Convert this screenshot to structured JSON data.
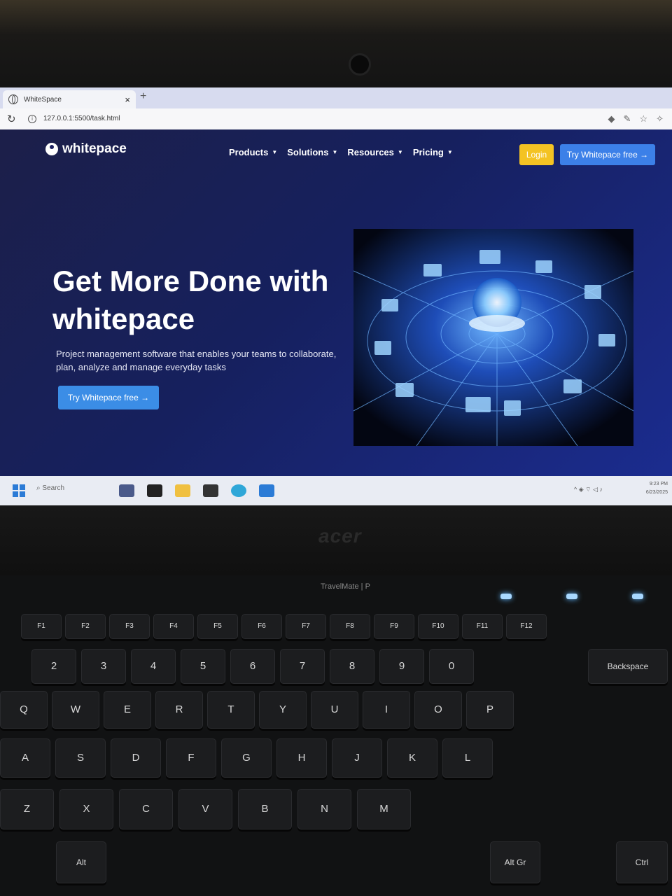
{
  "browser": {
    "tab_title": "WhiteSpace",
    "url": "127.0.0.1:5500/task.html",
    "new_tab": "+"
  },
  "site": {
    "logo": "whitepace",
    "nav": [
      {
        "label": "Products"
      },
      {
        "label": "Solutions"
      },
      {
        "label": "Resources"
      },
      {
        "label": "Pricing"
      }
    ],
    "login": "Login",
    "try_top": "Try Whitepace free →",
    "hero_title": "Get More Done with whitepace",
    "hero_subtitle": "Project management software that enables your teams to collaborate, plan, analyze and manage everyday tasks",
    "hero_button": "Try Whitepace free →",
    "colors": {
      "accent_blue": "#3c80e8",
      "login_yellow": "#f4c323",
      "bg": "#16205e"
    }
  },
  "taskbar": {
    "search": "Search",
    "time": "9:23 PM",
    "date": "6/23/2025"
  },
  "laptop": {
    "brand": "acer",
    "model": "TravelMate | P",
    "keys": [
      "F1",
      "F2",
      "F3",
      "F4",
      "F5",
      "F6",
      "F7",
      "F8",
      "F9",
      "F10",
      "F11",
      "F12",
      "2",
      "3",
      "4",
      "5",
      "6",
      "7",
      "8",
      "9",
      "0",
      "Q",
      "W",
      "E",
      "R",
      "T",
      "Y",
      "U",
      "I",
      "O",
      "P",
      "A",
      "S",
      "D",
      "F",
      "G",
      "H",
      "J",
      "K",
      "L",
      "Z",
      "X",
      "C",
      "V",
      "B",
      "N",
      "M",
      "Alt",
      "Alt Gr",
      "Ctrl",
      "Backspace"
    ]
  }
}
